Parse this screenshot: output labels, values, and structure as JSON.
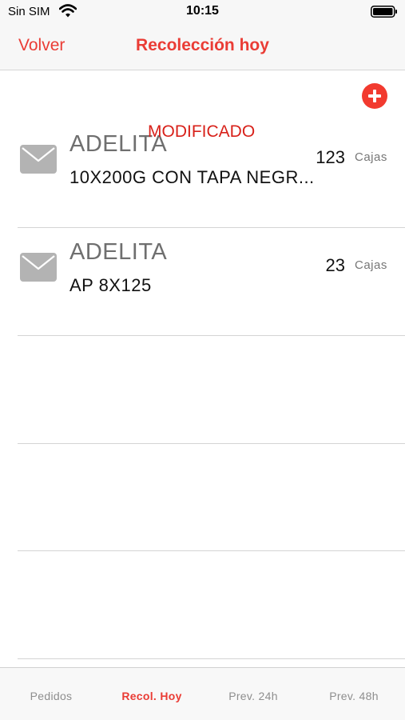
{
  "status_bar": {
    "carrier": "Sin SIM",
    "time": "10:15",
    "wifi_icon": "wifi-icon",
    "battery_icon": "battery-icon"
  },
  "nav": {
    "back_label": "Volver",
    "title": "Recolección hoy"
  },
  "add_button_icon": "plus-circle-icon",
  "colors": {
    "accent": "#ea3c35",
    "add_button": "#f23a2f",
    "modified": "#d8211a",
    "mail_icon": "#b3b3b3"
  },
  "list": {
    "items": [
      {
        "title": "ADELITA",
        "subtitle": "10X200G CON TAPA NEGR...",
        "quantity": "123",
        "unit": "Cajas",
        "badge": "MODIFICADO",
        "icon": "mail-icon"
      },
      {
        "title": "ADELITA",
        "subtitle": "AP 8X125",
        "quantity": "23",
        "unit": "Cajas",
        "badge": "",
        "icon": "mail-icon"
      }
    ]
  },
  "tabs": [
    {
      "label": "Pedidos",
      "active": false
    },
    {
      "label": "Recol. Hoy",
      "active": true
    },
    {
      "label": "Prev. 24h",
      "active": false
    },
    {
      "label": "Prev. 48h",
      "active": false
    }
  ]
}
